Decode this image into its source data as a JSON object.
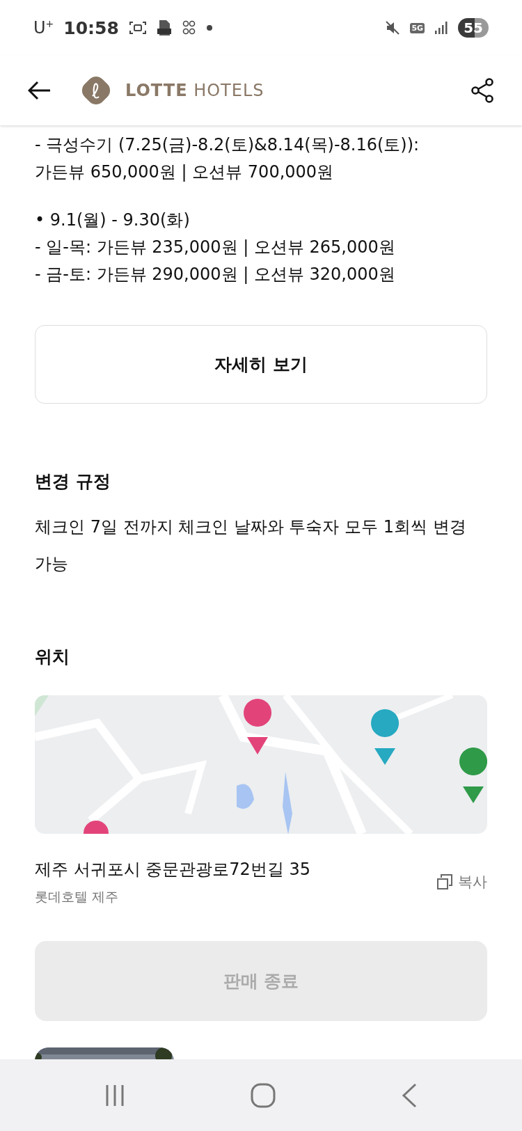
{
  "status_bar": {
    "carrier": "U$^{+}$",
    "time": "10:58",
    "network": "5G",
    "battery": "55"
  },
  "header": {
    "brand": "**LOTTE** HOTELS"
  },
  "rate_groups": [
    [
      "- 극성수기 (7.25(금)-8.2(토)&8.14(목)-8.16(토)):",
      "가든뷰 650,000원 | 오션뷰 700,000원"
    ],
    [
      "• 9.1(월) - 9.30(화)",
      "- 일-목: 가든뷰 235,000원 | 오션뷰 265,000원",
      "- 금-토: 가든뷰 290,000원 | 오션뷰 320,000원"
    ]
  ],
  "details_button": "자세히 보기",
  "change_policy": {
    "title": "변경 규정",
    "text": "체크인 7일 전까지 체크인 날짜와 투숙자 모두 1회씩 변경 가능"
  },
  "location": {
    "title": "위치",
    "map": {
      "kind": "picture"
    },
    "address": "제주 서귀포시 중문관광로72번길 35",
    "place": "롯데호텔 제주",
    "copy_button": "복사"
  },
  "sold_out_button": {
    "label": "판매 종료",
    "disabled": true
  },
  "thumbnails": [
    {
      "kind": "picture"
    }
  ]
}
